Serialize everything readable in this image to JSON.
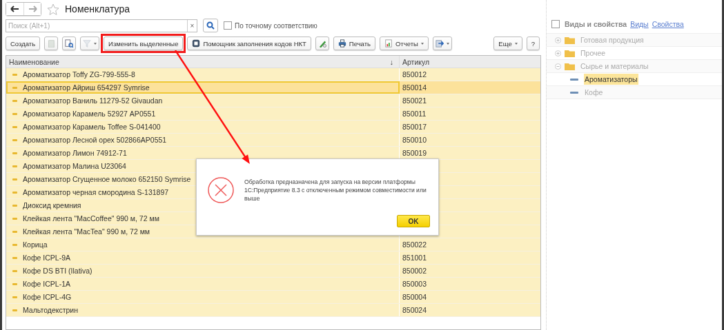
{
  "window": {
    "title": "Номенклатура",
    "nav": [
      {
        "kind": "back",
        "disabled": false
      },
      {
        "kind": "forward",
        "disabled": true
      }
    ],
    "favorite": false
  },
  "search": {
    "placeholder": "Поиск (Alt+1)",
    "clear": "×",
    "exact_match": {
      "label": "По точному соответствию",
      "checked": false
    }
  },
  "toolbar": [
    {
      "kind": "text",
      "label": "Создать",
      "highlighted": false
    },
    {
      "kind": "icon",
      "disabled": true
    },
    {
      "kind": "icon",
      "disabled": false
    },
    {
      "kind": "icon",
      "dropdown": true,
      "disabled": true
    },
    {
      "kind": "text",
      "label": "Изменить выделенные",
      "highlighted": true
    },
    {
      "kind": "text",
      "label": "Помощник заполнения кодов НКТ",
      "highlighted": false
    },
    {
      "kind": "icon",
      "disabled": false
    },
    {
      "kind": "text",
      "label": "Печать",
      "highlighted": false
    },
    {
      "kind": "text",
      "label": "Отчеты",
      "dropdown": true,
      "highlighted": false
    },
    {
      "kind": "icon",
      "dropdown": true,
      "disabled": false
    },
    {
      "kind": "spacer"
    },
    {
      "kind": "text",
      "label": "Еще",
      "dropdown": true,
      "highlighted": false
    },
    {
      "kind": "text",
      "label": "?",
      "highlighted": false
    }
  ],
  "table": {
    "columns": [
      {
        "label": "Наименование",
        "sort": "↓"
      },
      {
        "label": "Артикул"
      }
    ],
    "rows": [
      {
        "name": "Ароматизатор Toffy ZG-799-555-8",
        "article": "850012",
        "selected": false
      },
      {
        "name": "Ароматизатор Айриш 654297 Symrise",
        "article": "850014",
        "selected": true
      },
      {
        "name": "Ароматизатор Ваниль 11279-52  Givaudan",
        "article": "850021",
        "selected": false
      },
      {
        "name": "Ароматизатор Карамель 52927 AP0551",
        "article": "850011",
        "selected": false
      },
      {
        "name": "Ароматизатор Карамель Toffee S-041400",
        "article": "850017",
        "selected": false
      },
      {
        "name": "Ароматизатор Лесной орех 502866AP0551",
        "article": "850010",
        "selected": false
      },
      {
        "name": "Ароматизатор Лимон 74912-71",
        "article": "850019",
        "selected": false
      },
      {
        "name": "Ароматизатор Малина U23064",
        "selected": false
      },
      {
        "name": "Ароматизатор Сгущенное молоко 652150 Symrise",
        "selected": false
      },
      {
        "name": "Ароматизатор черная смородина S-131897",
        "selected": false
      },
      {
        "name": "Диоксид кремния",
        "selected": false
      },
      {
        "name": "Клейкая лента \"MacCoffee\" 990 м, 72 мм",
        "selected": false
      },
      {
        "name": "Клейкая лента \"MacTea\" 990 м, 72 мм",
        "selected": false
      },
      {
        "name": "Корица",
        "article": "850022",
        "selected": false
      },
      {
        "name": "Кофе ICPL-9A",
        "article": "851001",
        "selected": false
      },
      {
        "name": "Кофе DS BTI (Ilativa)",
        "article": "850002",
        "selected": false
      },
      {
        "name": "Кофе ICPL-1A",
        "article": "850003",
        "selected": false
      },
      {
        "name": "Кофе ICPL-4G",
        "article": "850004",
        "selected": false
      },
      {
        "name": "Мальтодекстрин",
        "article": "850024",
        "selected": false
      }
    ]
  },
  "sidebar": {
    "checkbox": {
      "label": "Виды и свойства",
      "checked": false
    },
    "links": [
      "Виды",
      "Свойства"
    ],
    "items": [
      {
        "label": "Готовая продукция",
        "kind": "folder",
        "expanded": false,
        "selected": false
      },
      {
        "label": "Прочее",
        "kind": "folder",
        "expanded": false,
        "selected": false
      },
      {
        "label": "Сырье и материалы",
        "kind": "folder",
        "expanded": true,
        "selected": false,
        "children": [
          {
            "label": "Ароматизаторы",
            "kind": "leaf",
            "selected": true
          },
          {
            "label": "Кофе",
            "kind": "leaf",
            "selected": false
          }
        ]
      }
    ]
  },
  "dialog": {
    "kind": "error",
    "message": "Обработка предназначена для запуска на версии платформы 1С:Предприятие 8.3 с отключенным режимом совместимости или выше",
    "button": "OK"
  }
}
